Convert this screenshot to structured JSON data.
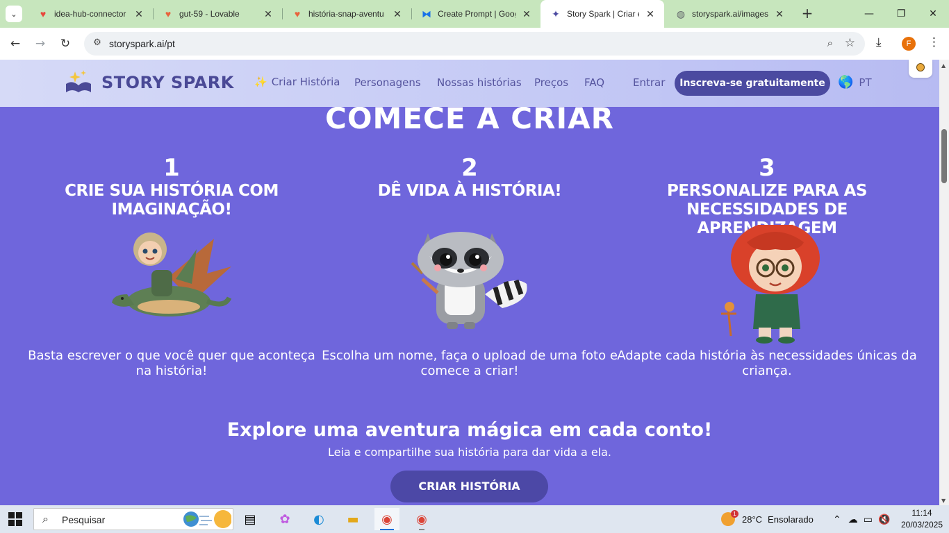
{
  "browser": {
    "tabs": [
      {
        "title": "idea-hub-connector -",
        "icon": "heart-gradient-icon"
      },
      {
        "title": "gut-59 - Lovable",
        "icon": "heart-gradient-icon"
      },
      {
        "title": "história-snap-aventu",
        "icon": "heart-gradient-icon"
      },
      {
        "title": "Create Prompt | Goog",
        "icon": "butterfly-icon"
      },
      {
        "title": "Story Spark | Criar e L",
        "icon": "story-spark-icon",
        "active": true
      },
      {
        "title": "storyspark.ai/images\\",
        "icon": "globe-icon"
      }
    ],
    "url": "storyspark.ai/pt",
    "profile_initial": "F"
  },
  "site": {
    "logo_text": "STORY SPARK",
    "nav": {
      "create": "Criar História",
      "characters": "Personagens",
      "stories": "Nossas histórias",
      "pricing": "Preços",
      "faq": "FAQ",
      "login": "Entrar",
      "signup": "Inscreva-se gratuitamente",
      "lang": "PT"
    },
    "section_title": "COMECE A CRIAR",
    "steps": [
      {
        "num": "1",
        "title": "CRIE SUA HISTÓRIA COM IMAGINAÇÃO!",
        "desc": "Basta escrever o que você quer que aconteça na história!"
      },
      {
        "num": "2",
        "title": "DÊ VIDA À HISTÓRIA!",
        "desc": "Escolha um nome, faça o upload de uma foto e comece a criar!"
      },
      {
        "num": "3",
        "title": "PERSONALIZE PARA AS NECESSIDADES DE APRENDIZAGEM",
        "desc": "Adapte cada história às necessidades únicas da criança."
      }
    ],
    "explore_title": "Explore uma aventura mágica em cada conto!",
    "explore_sub": "Leia e compartilhe sua história para dar vida a ela.",
    "cta": "CRIAR HISTÓRIA",
    "colors": {
      "background": "#6f66dc",
      "brand": "#4b4aa0",
      "header": "#c4c9f5"
    }
  },
  "taskbar": {
    "search_placeholder": "Pesquisar",
    "weather_temp": "28°C",
    "weather_desc": "Ensolarado",
    "weather_badge": "1",
    "time": "11:14",
    "date": "20/03/2025"
  }
}
